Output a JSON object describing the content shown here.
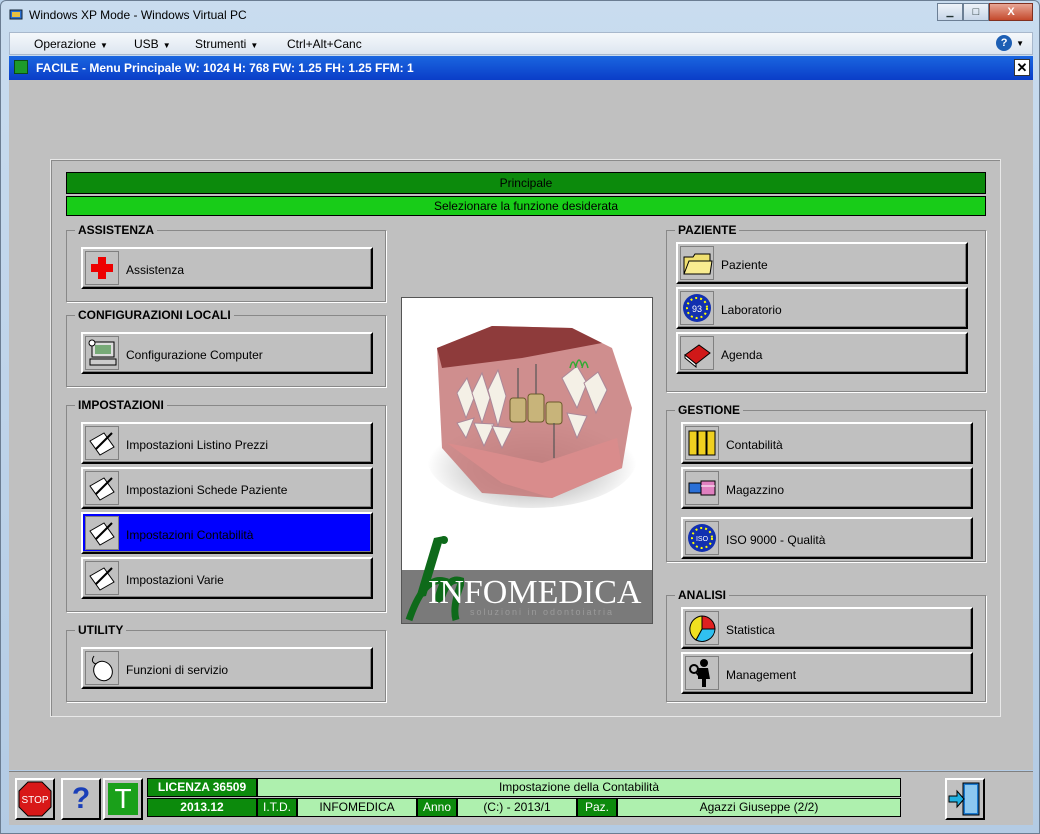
{
  "window": {
    "title": "Windows XP Mode - Windows Virtual PC",
    "minimize_label": "▭",
    "restore_label": "□",
    "close_label": "X"
  },
  "menubar": {
    "items": [
      {
        "label": "Operazione"
      },
      {
        "label": "USB"
      },
      {
        "label": "Strumenti"
      },
      {
        "label": "Ctrl+Alt+Canc"
      }
    ]
  },
  "app": {
    "title": "FACILE - Menu Principale W: 1024 H: 768 FW: 1.25 FH: 1.25 FFM:  1",
    "close_label": "✕"
  },
  "header": {
    "title": "Principale",
    "subtitle": "Selezionare la funzione desiderata"
  },
  "groups": {
    "assistenza": {
      "label": "ASSISTENZA",
      "buttons": [
        {
          "label": "Assistenza"
        }
      ]
    },
    "config": {
      "label": "CONFIGURAZIONI LOCALI",
      "buttons": [
        {
          "label": "Configurazione Computer"
        }
      ]
    },
    "impostazioni": {
      "label": "IMPOSTAZIONI",
      "buttons": [
        {
          "label": "Impostazioni Listino Prezzi"
        },
        {
          "label": "Impostazioni Schede Paziente"
        },
        {
          "label": "Impostazioni Contabilità"
        },
        {
          "label": "Impostazioni Varie"
        }
      ]
    },
    "utility": {
      "label": "UTILITY",
      "buttons": [
        {
          "label": "Funzioni di servizio"
        }
      ]
    },
    "paziente": {
      "label": "PAZIENTE",
      "buttons": [
        {
          "label": "Paziente"
        },
        {
          "label": "Laboratorio"
        },
        {
          "label": "Agenda"
        }
      ]
    },
    "gestione": {
      "label": "GESTIONE",
      "buttons": [
        {
          "label": "Contabilità"
        },
        {
          "label": "Magazzino"
        },
        {
          "label": "ISO 9000 - Qualità"
        }
      ]
    },
    "analisi": {
      "label": "ANALISI",
      "buttons": [
        {
          "label": "Statistica"
        },
        {
          "label": "Management"
        }
      ]
    }
  },
  "logo": {
    "brand": "INFOMEDICA",
    "tagline": "soluzioni in odontoiatria"
  },
  "status": {
    "stop_label": "STOP",
    "help_label": "?",
    "t_label": "T",
    "licenza": "LICENZA 36509",
    "current_function": "Impostazione della Contabilità",
    "version": "2013.12",
    "itd_label": "I.T.D.",
    "company": "INFOMEDICA",
    "anno_label": "Anno",
    "anno_value": "(C:) - 2013/1",
    "paz_label": "Paz.",
    "patient": "Agazzi Giuseppe (2/2)"
  }
}
